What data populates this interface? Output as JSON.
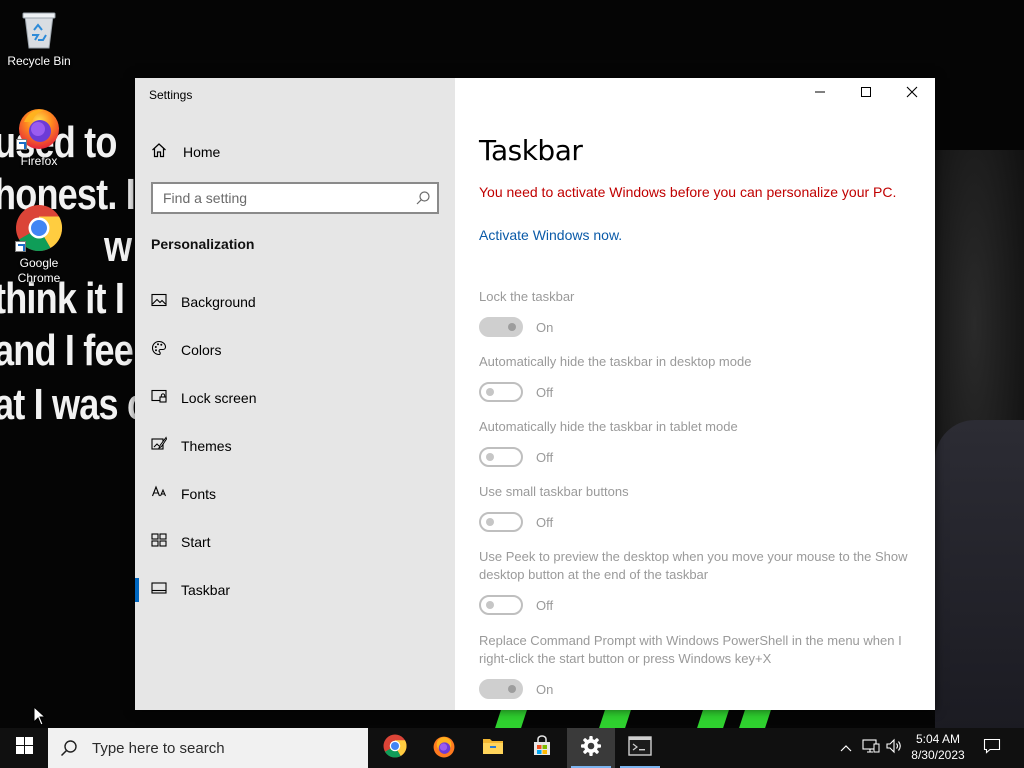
{
  "desktop": {
    "wallpaper_lines": [
      "used to",
      "honest. I",
      "w",
      "think it I",
      "and I fee",
      "at I was c"
    ],
    "icons": [
      {
        "label": "Recycle Bin",
        "icon": "recycle-bin-icon"
      },
      {
        "label": "Firefox",
        "icon": "firefox-icon"
      },
      {
        "label": "Google Chrome",
        "icon": "chrome-icon"
      }
    ]
  },
  "window": {
    "app_title": "Settings",
    "controls": {
      "minimize": "minimize-icon",
      "maximize": "maximize-icon",
      "close": "close-icon"
    }
  },
  "nav": {
    "home_label": "Home",
    "search_placeholder": "Find a setting",
    "section_title": "Personalization",
    "items": [
      {
        "label": "Background",
        "icon": "picture-icon"
      },
      {
        "label": "Colors",
        "icon": "palette-icon"
      },
      {
        "label": "Lock screen",
        "icon": "lock-screen-icon"
      },
      {
        "label": "Themes",
        "icon": "themes-icon"
      },
      {
        "label": "Fonts",
        "icon": "fonts-icon"
      },
      {
        "label": "Start",
        "icon": "start-icon"
      },
      {
        "label": "Taskbar",
        "icon": "taskbar-icon",
        "selected": true
      }
    ]
  },
  "content": {
    "title": "Taskbar",
    "warning": "You need to activate Windows before you can personalize your PC.",
    "activate_link": "Activate Windows now.",
    "settings": [
      {
        "label": "Lock the taskbar",
        "state": "On"
      },
      {
        "label": "Automatically hide the taskbar in desktop mode",
        "state": "Off"
      },
      {
        "label": "Automatically hide the taskbar in tablet mode",
        "state": "Off"
      },
      {
        "label": "Use small taskbar buttons",
        "state": "Off"
      },
      {
        "label": "Use Peek to preview the desktop when you move your mouse to the Show desktop button at the end of the taskbar",
        "state": "Off"
      },
      {
        "label": "Replace Command Prompt with Windows PowerShell in the menu when I right-click the start button or press Windows key+X",
        "state": "On"
      }
    ]
  },
  "taskbar": {
    "search_placeholder": "Type here to search",
    "apps": [
      "chrome-icon",
      "firefox-icon",
      "file-explorer-icon",
      "store-icon",
      "settings-icon",
      "terminal-icon"
    ],
    "tray": [
      "chevron-up-icon",
      "network-icon",
      "volume-icon"
    ],
    "time": "5:04 AM",
    "date": "8/30/2023",
    "notification_icon": "notification-icon"
  },
  "colors": {
    "accent": "#0067c0",
    "warning": "#c00000",
    "link": "#0a5aa8",
    "nav_bg": "#e6e6e6",
    "taskbar_bg": "#101010"
  }
}
